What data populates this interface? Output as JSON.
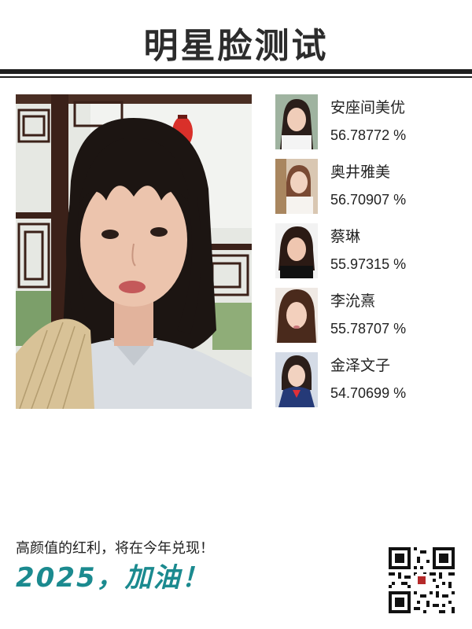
{
  "header": {
    "title": "明星脸测试"
  },
  "matches": [
    {
      "name": "安座间美优",
      "score": "56.78772 %"
    },
    {
      "name": "奥井雅美",
      "score": "56.70907 %"
    },
    {
      "name": "蔡琳",
      "score": "55.97315 %"
    },
    {
      "name": "李沇熹",
      "score": "55.78707 %"
    },
    {
      "name": "金泽文子",
      "score": "54.70699 %"
    }
  ],
  "footer": {
    "slogan": "高颜值的红利，将在今年兑现！",
    "cheer": "2025，加油！"
  }
}
